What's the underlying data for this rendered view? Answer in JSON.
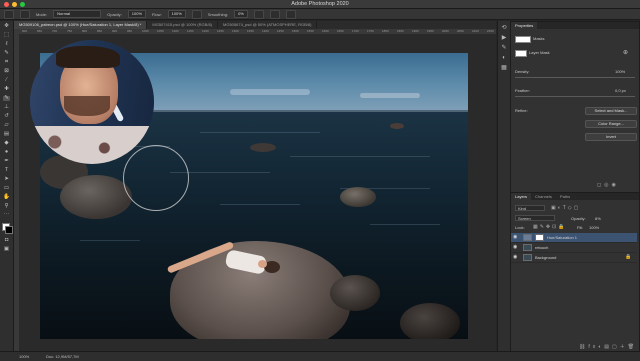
{
  "app": {
    "title": "Adobe Photoshop 2020"
  },
  "options_bar": {
    "mode_label": "Mode:",
    "mode_value": "Normal",
    "opacity_label": "Opacity:",
    "opacity_value": "100%",
    "flow_label": "Flow:",
    "flow_value": "100%",
    "smoothing_label": "Smoothing:",
    "smoothing_value": "0%"
  },
  "tabs": [
    {
      "label": "MG509106_patreon.psd @ 100% (Hue/Saturation 1, Layer Mask/8) *"
    },
    {
      "label": "MG507415.psd @ 100% (RGB/8)"
    },
    {
      "label": "MG505674_psd @ 50% (ATMOSPHERE, RGB/8)"
    }
  ],
  "ruler": {
    "ticks": [
      "600",
      "650",
      "700",
      "750",
      "800",
      "850",
      "900",
      "950",
      "1000",
      "1050",
      "1100",
      "1150",
      "1200",
      "1250",
      "1300",
      "1350",
      "1400",
      "1450",
      "1500",
      "1550",
      "1600",
      "1650",
      "1700",
      "1750",
      "1800",
      "1850",
      "1900",
      "1950",
      "2000",
      "2050",
      "2100",
      "2150"
    ]
  },
  "status": {
    "zoom": "100%",
    "doc_info": "Doc: 12,9M/57,7M"
  },
  "properties": {
    "title": "Properties",
    "masks_label": "Masks",
    "layer_mask_label": "Layer Mask",
    "density_label": "Density:",
    "density_value": "100%",
    "feather_label": "Feather:",
    "feather_value": "0,0 px",
    "refine_label": "Refine:",
    "select_mask_button": "Select and Mask...",
    "color_range_button": "Color Range...",
    "invert_button": "Invert"
  },
  "layers_panel": {
    "tabs": [
      "Layers",
      "Channels",
      "Paths"
    ],
    "kind_label": "Kind",
    "blend_mode": "Screen",
    "opacity_label": "Opacity:",
    "opacity_value": "8%",
    "lock_label": "Lock:",
    "fill_label": "Fill:",
    "fill_value": "100%",
    "layers": [
      {
        "name": "Hue/Saturation 1",
        "selected": true
      },
      {
        "name": "retouch",
        "selected": false
      },
      {
        "name": "Background",
        "selected": false
      }
    ]
  },
  "colors": {
    "accent": "#3d5372",
    "panel_bg": "#323232",
    "canvas_bg": "#2a2a2a"
  }
}
